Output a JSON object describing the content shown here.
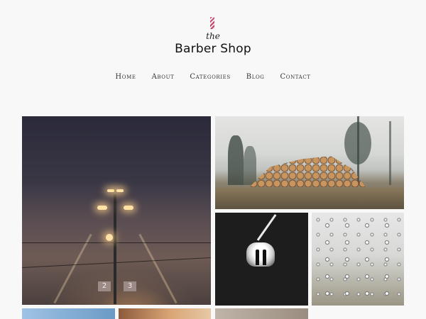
{
  "logo": {
    "the": "the",
    "title": "Barber Shop"
  },
  "nav": [
    {
      "label": "Home"
    },
    {
      "label": "About"
    },
    {
      "label": "Categories"
    },
    {
      "label": "Blog"
    },
    {
      "label": "Contact"
    }
  ],
  "gallery": {
    "station_signs": [
      "2",
      "3"
    ]
  }
}
